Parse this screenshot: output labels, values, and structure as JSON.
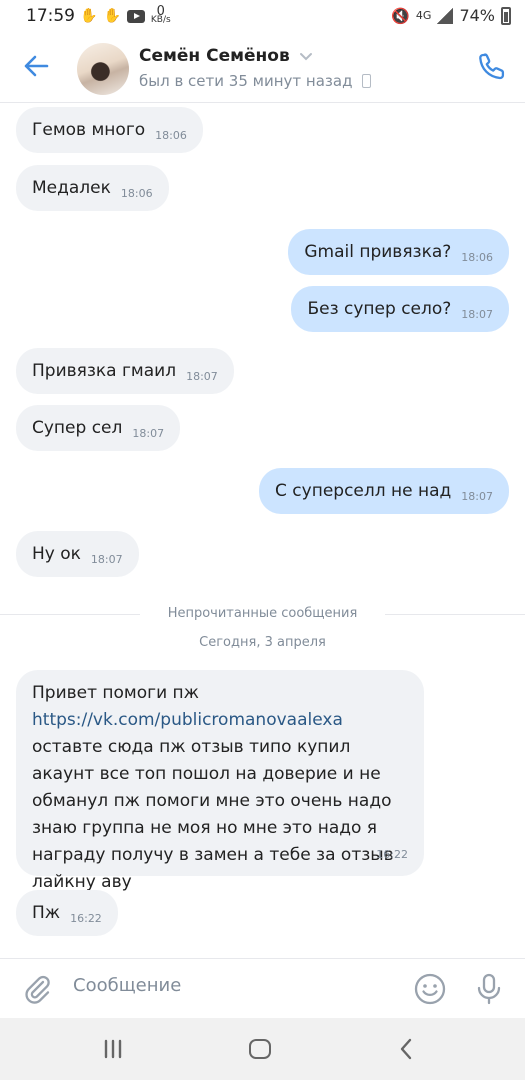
{
  "status_bar": {
    "time": "17:59",
    "network_speed_value": "0",
    "network_speed_unit": "KB/s",
    "network_type": "4G",
    "battery": "74%"
  },
  "header": {
    "name": "Семён Семёнов",
    "status": "был в сети 35 минут назад"
  },
  "messages": [
    {
      "text": "Гемов много",
      "time": "18:06"
    },
    {
      "text": "Медалек",
      "time": "18:06"
    },
    {
      "text": "Gmail привязка?",
      "time": "18:06"
    },
    {
      "text": "Без супер село?",
      "time": "18:07"
    },
    {
      "text": "Привязка гмаил",
      "time": "18:07"
    },
    {
      "text": "Супер сел",
      "time": "18:07"
    },
    {
      "text": "С суперселл не над",
      "time": "18:07"
    },
    {
      "text": "Ну ок",
      "time": "18:07"
    },
    {
      "text_before": "Привет помоги пж ",
      "link": "https://vk.com/publicromanovaalexa",
      "text_after": " оставте сюда пж отзыв типо купил акаунт все топ пошол на доверие и не обманул пж помоги мне это очень надо знаю группа не моя но мне это надо я награду получу в замен а тебе за отзыв лайкну аву",
      "time": "16:22"
    },
    {
      "text": "Пж",
      "time": "16:22"
    }
  ],
  "unread_divider": "Непрочитанные сообщения",
  "date_divider": "Сегодня, 3 апреля",
  "composer": {
    "placeholder": "Сообщение"
  },
  "colors": {
    "accent": "#3f8ae0",
    "incoming_bubble": "#f0f2f5",
    "outgoing_bubble": "#cce4ff",
    "link": "#2a5885"
  }
}
